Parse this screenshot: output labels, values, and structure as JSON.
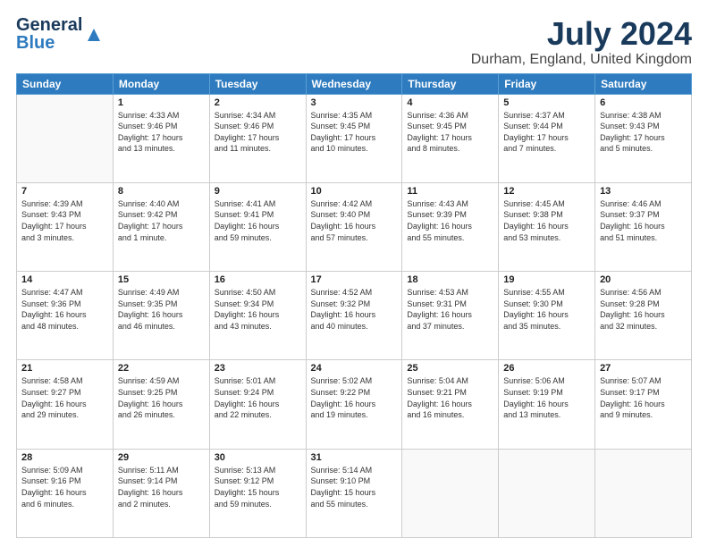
{
  "header": {
    "logo": {
      "general": "General",
      "blue": "Blue"
    },
    "title": "July 2024",
    "subtitle": "Durham, England, United Kingdom"
  },
  "weekdays": [
    "Sunday",
    "Monday",
    "Tuesday",
    "Wednesday",
    "Thursday",
    "Friday",
    "Saturday"
  ],
  "weeks": [
    [
      {
        "day": "",
        "info": ""
      },
      {
        "day": "1",
        "info": "Sunrise: 4:33 AM\nSunset: 9:46 PM\nDaylight: 17 hours\nand 13 minutes."
      },
      {
        "day": "2",
        "info": "Sunrise: 4:34 AM\nSunset: 9:46 PM\nDaylight: 17 hours\nand 11 minutes."
      },
      {
        "day": "3",
        "info": "Sunrise: 4:35 AM\nSunset: 9:45 PM\nDaylight: 17 hours\nand 10 minutes."
      },
      {
        "day": "4",
        "info": "Sunrise: 4:36 AM\nSunset: 9:45 PM\nDaylight: 17 hours\nand 8 minutes."
      },
      {
        "day": "5",
        "info": "Sunrise: 4:37 AM\nSunset: 9:44 PM\nDaylight: 17 hours\nand 7 minutes."
      },
      {
        "day": "6",
        "info": "Sunrise: 4:38 AM\nSunset: 9:43 PM\nDaylight: 17 hours\nand 5 minutes."
      }
    ],
    [
      {
        "day": "7",
        "info": "Sunrise: 4:39 AM\nSunset: 9:43 PM\nDaylight: 17 hours\nand 3 minutes."
      },
      {
        "day": "8",
        "info": "Sunrise: 4:40 AM\nSunset: 9:42 PM\nDaylight: 17 hours\nand 1 minute."
      },
      {
        "day": "9",
        "info": "Sunrise: 4:41 AM\nSunset: 9:41 PM\nDaylight: 16 hours\nand 59 minutes."
      },
      {
        "day": "10",
        "info": "Sunrise: 4:42 AM\nSunset: 9:40 PM\nDaylight: 16 hours\nand 57 minutes."
      },
      {
        "day": "11",
        "info": "Sunrise: 4:43 AM\nSunset: 9:39 PM\nDaylight: 16 hours\nand 55 minutes."
      },
      {
        "day": "12",
        "info": "Sunrise: 4:45 AM\nSunset: 9:38 PM\nDaylight: 16 hours\nand 53 minutes."
      },
      {
        "day": "13",
        "info": "Sunrise: 4:46 AM\nSunset: 9:37 PM\nDaylight: 16 hours\nand 51 minutes."
      }
    ],
    [
      {
        "day": "14",
        "info": "Sunrise: 4:47 AM\nSunset: 9:36 PM\nDaylight: 16 hours\nand 48 minutes."
      },
      {
        "day": "15",
        "info": "Sunrise: 4:49 AM\nSunset: 9:35 PM\nDaylight: 16 hours\nand 46 minutes."
      },
      {
        "day": "16",
        "info": "Sunrise: 4:50 AM\nSunset: 9:34 PM\nDaylight: 16 hours\nand 43 minutes."
      },
      {
        "day": "17",
        "info": "Sunrise: 4:52 AM\nSunset: 9:32 PM\nDaylight: 16 hours\nand 40 minutes."
      },
      {
        "day": "18",
        "info": "Sunrise: 4:53 AM\nSunset: 9:31 PM\nDaylight: 16 hours\nand 37 minutes."
      },
      {
        "day": "19",
        "info": "Sunrise: 4:55 AM\nSunset: 9:30 PM\nDaylight: 16 hours\nand 35 minutes."
      },
      {
        "day": "20",
        "info": "Sunrise: 4:56 AM\nSunset: 9:28 PM\nDaylight: 16 hours\nand 32 minutes."
      }
    ],
    [
      {
        "day": "21",
        "info": "Sunrise: 4:58 AM\nSunset: 9:27 PM\nDaylight: 16 hours\nand 29 minutes."
      },
      {
        "day": "22",
        "info": "Sunrise: 4:59 AM\nSunset: 9:25 PM\nDaylight: 16 hours\nand 26 minutes."
      },
      {
        "day": "23",
        "info": "Sunrise: 5:01 AM\nSunset: 9:24 PM\nDaylight: 16 hours\nand 22 minutes."
      },
      {
        "day": "24",
        "info": "Sunrise: 5:02 AM\nSunset: 9:22 PM\nDaylight: 16 hours\nand 19 minutes."
      },
      {
        "day": "25",
        "info": "Sunrise: 5:04 AM\nSunset: 9:21 PM\nDaylight: 16 hours\nand 16 minutes."
      },
      {
        "day": "26",
        "info": "Sunrise: 5:06 AM\nSunset: 9:19 PM\nDaylight: 16 hours\nand 13 minutes."
      },
      {
        "day": "27",
        "info": "Sunrise: 5:07 AM\nSunset: 9:17 PM\nDaylight: 16 hours\nand 9 minutes."
      }
    ],
    [
      {
        "day": "28",
        "info": "Sunrise: 5:09 AM\nSunset: 9:16 PM\nDaylight: 16 hours\nand 6 minutes."
      },
      {
        "day": "29",
        "info": "Sunrise: 5:11 AM\nSunset: 9:14 PM\nDaylight: 16 hours\nand 2 minutes."
      },
      {
        "day": "30",
        "info": "Sunrise: 5:13 AM\nSunset: 9:12 PM\nDaylight: 15 hours\nand 59 minutes."
      },
      {
        "day": "31",
        "info": "Sunrise: 5:14 AM\nSunset: 9:10 PM\nDaylight: 15 hours\nand 55 minutes."
      },
      {
        "day": "",
        "info": ""
      },
      {
        "day": "",
        "info": ""
      },
      {
        "day": "",
        "info": ""
      }
    ]
  ]
}
